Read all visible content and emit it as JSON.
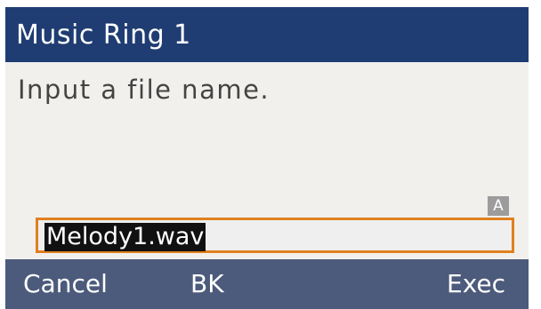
{
  "header": {
    "title": "Music Ring 1"
  },
  "content": {
    "prompt": "Input a file name.",
    "input_mode_badge": "A",
    "input_value": "Melody1.wav"
  },
  "softkeys": {
    "left": "Cancel",
    "center": "BK",
    "right": "Exec"
  },
  "colors": {
    "title_bar": "#1f3d72",
    "softkey_bar": "#4c5a7c",
    "content_bg": "#f1f0ed",
    "input_border": "#e0801f",
    "badge_bg": "#9c9c9c"
  }
}
